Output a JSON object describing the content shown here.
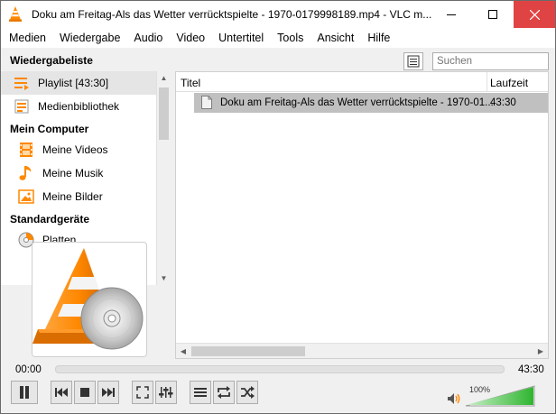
{
  "window": {
    "title": "Doku am Freitag-Als das Wetter verrücktspielte - 1970-0179998189.mp4 - VLC m...",
    "close_color": "#e04343"
  },
  "menu": [
    "Medien",
    "Wiedergabe",
    "Audio",
    "Video",
    "Untertitel",
    "Tools",
    "Ansicht",
    "Hilfe"
  ],
  "sidebar": {
    "header": "Wiedergabeliste",
    "items": [
      {
        "label": "Playlist [43:30]",
        "icon": "playlist-icon",
        "selected": true
      },
      {
        "label": "Medienbibliothek",
        "icon": "media-library-icon"
      }
    ],
    "my_computer": {
      "heading": "Mein Computer",
      "items": [
        {
          "label": "Meine Videos",
          "icon": "film-icon"
        },
        {
          "label": "Meine Musik",
          "icon": "music-note-icon"
        },
        {
          "label": "Meine Bilder",
          "icon": "picture-icon"
        }
      ]
    },
    "devices": {
      "heading": "Standardgeräte",
      "items": [
        {
          "label": "Platten",
          "icon": "disc-icon"
        }
      ]
    }
  },
  "search": {
    "placeholder": "Suchen"
  },
  "playlist": {
    "columns": [
      "Titel",
      "Laufzeit"
    ],
    "rows": [
      {
        "title": "Doku am Freitag-Als das Wetter verrücktspielte - 1970-01...",
        "duration": "43:30"
      }
    ]
  },
  "player": {
    "elapsed": "00:00",
    "total": "43:30",
    "progress": 0.0,
    "volume_percent": "100%",
    "volume_level": 1.0,
    "accent": "#ff8800",
    "volume_color": "#2fb52f"
  }
}
